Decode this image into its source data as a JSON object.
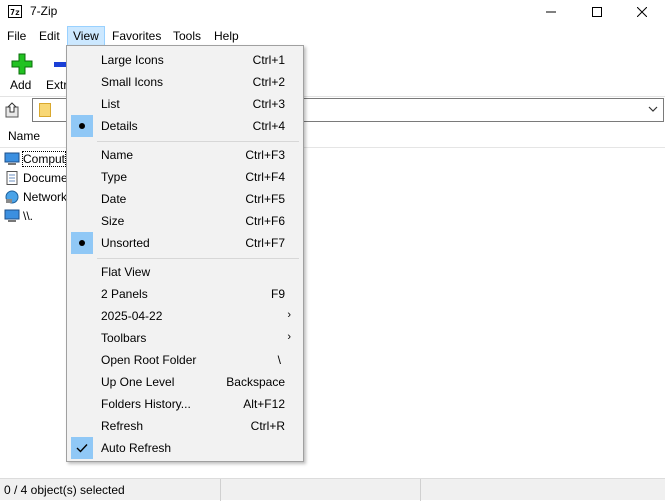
{
  "window": {
    "title": "7-Zip",
    "app_icon_text": "7z"
  },
  "menubar": [
    "File",
    "Edit",
    "View",
    "Favorites",
    "Tools",
    "Help"
  ],
  "toolbar": {
    "add_label": "Add",
    "extract_label": "Extr"
  },
  "file_list": {
    "column_name": "Name",
    "rows": [
      {
        "label": "Comput",
        "icon": "computer-icon"
      },
      {
        "label": "Docume",
        "icon": "documents-icon"
      },
      {
        "label": "Network",
        "icon": "network-icon"
      },
      {
        "label": "\\\\.",
        "icon": "monitor-icon"
      }
    ]
  },
  "status": {
    "text": "0 / 4 object(s) selected"
  },
  "view_menu": {
    "items": [
      {
        "label": "Large Icons",
        "shortcut": "Ctrl+1",
        "mark": ""
      },
      {
        "label": "Small Icons",
        "shortcut": "Ctrl+2",
        "mark": ""
      },
      {
        "label": "List",
        "shortcut": "Ctrl+3",
        "mark": ""
      },
      {
        "label": "Details",
        "shortcut": "Ctrl+4",
        "mark": "bullet"
      },
      {
        "label": "Name",
        "shortcut": "Ctrl+F3",
        "mark": ""
      },
      {
        "label": "Type",
        "shortcut": "Ctrl+F4",
        "mark": ""
      },
      {
        "label": "Date",
        "shortcut": "Ctrl+F5",
        "mark": ""
      },
      {
        "label": "Size",
        "shortcut": "Ctrl+F6",
        "mark": ""
      },
      {
        "label": "Unsorted",
        "shortcut": "Ctrl+F7",
        "mark": "bullet"
      },
      {
        "label": "Flat View",
        "shortcut": "",
        "mark": ""
      },
      {
        "label": "2 Panels",
        "shortcut": "F9",
        "mark": ""
      },
      {
        "label": "2025-04-22",
        "shortcut": "",
        "mark": "",
        "submenu": true
      },
      {
        "label": "Toolbars",
        "shortcut": "",
        "mark": "",
        "submenu": true
      },
      {
        "label": "Open Root Folder",
        "shortcut": "\\",
        "mark": ""
      },
      {
        "label": "Up One Level",
        "shortcut": "Backspace",
        "mark": ""
      },
      {
        "label": "Folders History...",
        "shortcut": "Alt+F12",
        "mark": ""
      },
      {
        "label": "Refresh",
        "shortcut": "Ctrl+R",
        "mark": ""
      },
      {
        "label": "Auto Refresh",
        "shortcut": "",
        "mark": "check"
      }
    ]
  },
  "colors": {
    "menu_highlight": "#cce8ff",
    "check_bg": "#90c8f6",
    "menu_bg": "#f2f2f2",
    "add_icon": "#22c222",
    "extract_icon": "#1a3fd6"
  }
}
